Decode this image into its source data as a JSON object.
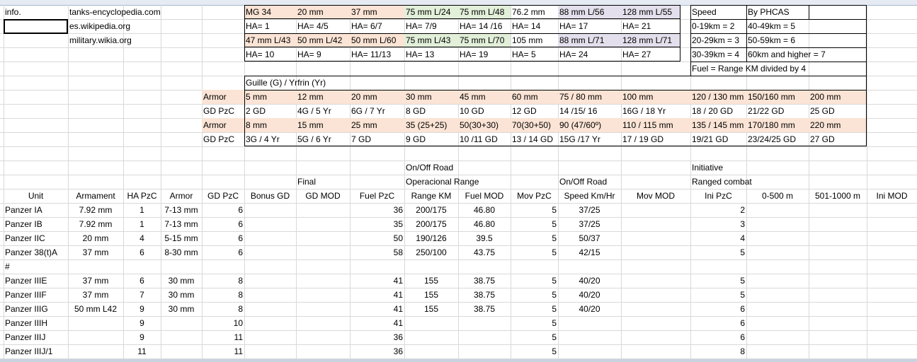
{
  "sources": [
    "info.",
    "tanks-encyclopedia.com",
    "es.wikipedia.org",
    "military.wikia.org"
  ],
  "guns_row1": [
    "MG 34",
    "20 mm",
    "37 mm",
    "75 mm L/24",
    "75 mm L/48",
    "76.2 mm",
    "88 mm L/56",
    "128 mm L/55"
  ],
  "ha_row1": [
    "HA= 1",
    "HA= 4/5",
    "HA= 6/7",
    "HA= 7/9",
    "HA= 14 /16",
    "HA= 14",
    "HA= 17",
    "HA= 21"
  ],
  "guns_row2": [
    "47 mm L/43",
    "50 mm L/42",
    "50 mm L/60",
    "75 mm L/43",
    "75 mm L/70",
    "105 mm",
    "88 mm L/71",
    "128 mm L/71"
  ],
  "ha_row2": [
    "HA= 10",
    "HA= 9",
    "HA= 11/13",
    "HA= 13",
    "HA= 19",
    "HA=  5",
    "HA= 24",
    "HA= 27"
  ],
  "speed": {
    "title": "Speed",
    "by": "By PHCAS",
    "rows": [
      [
        "0-19km = 2",
        "40-49km = 5"
      ],
      [
        "20-29km = 3",
        "50-59km = 6"
      ],
      [
        "30-39km = 4",
        "60km and higher = 7"
      ]
    ],
    "fuel": "Fuel = Range KM divided by 4"
  },
  "guille": "Guille (G) / Yrfrin (Yr)",
  "armor_rows": [
    {
      "label": "Armor",
      "vals": [
        "5 mm",
        "12 mm",
        "20 mm",
        "30 mm",
        "45 mm",
        "60 mm",
        "75 / 80 mm",
        "100 mm",
        "120 / 130 mm",
        "150/160 mm",
        "200 mm"
      ]
    },
    {
      "label": "GD PzC",
      "vals": [
        "2 GD",
        "4G / 5 Yr",
        "6G / 7 Yr",
        "8 GD",
        "10 GD",
        "12 GD",
        "14 /15/ 16",
        "16G / 18 Yr",
        "18 / 20 GD",
        "21/22 GD",
        "25 GD"
      ]
    },
    {
      "label": "Armor",
      "vals": [
        "8 mm",
        "15 mm",
        "25 mm",
        "35 (25+25)",
        "50(30+30)",
        "70(30+50)",
        "90 (47/60º)",
        "110 / 115 mm",
        "135 / 145 mm",
        "170/180 mm",
        "220 mm"
      ]
    },
    {
      "label": "GD PzC",
      "vals": [
        "3G / 4 Yr",
        "5G / 6 Yr",
        "7 GD",
        "9 GD",
        "10 /11 GD",
        "13 / 14 GD",
        "15G /17 Yr",
        "17 / 19 GD",
        "19/21 GD",
        "23/24/25 GD",
        "27 GD"
      ]
    }
  ],
  "group_headers": {
    "on_off_road_1": "On/Off Road",
    "final": "Final",
    "operacional": "Operacional Range",
    "on_off_road_2": "On/Off Road",
    "initiative": "Initiative",
    "ranged": "Ranged combat"
  },
  "columns": [
    "Unit",
    "Armament",
    "HA PzC",
    "Armor",
    "GD PzC",
    "Bonus GD",
    "GD MOD",
    "Fuel PzC",
    "Range KM",
    "Fuel MOD",
    "Mov PzC",
    "Speed Km/Hr",
    "Mov MOD",
    "Ini PzC",
    "0-500 m",
    "501-1000 m",
    "Ini MOD"
  ],
  "units": [
    {
      "unit": "Panzer IA",
      "arm": "7.92 mm",
      "ha": "1",
      "armor": "7-13 mm",
      "gd": "6",
      "fuel": "36",
      "range": "200/175",
      "fmod": "46.80",
      "mov": "5",
      "speed": "37/25",
      "ini": "2"
    },
    {
      "unit": "Panzer IB",
      "arm": "7.92 mm",
      "ha": "1",
      "armor": "7-13 mm",
      "gd": "6",
      "fuel": "35",
      "range": "200/175",
      "fmod": "46.80",
      "mov": "5",
      "speed": "37/25",
      "ini": "3"
    },
    {
      "unit": "Panzer IIC",
      "arm": "20 mm",
      "ha": "4",
      "armor": "5-15 mm",
      "gd": "6",
      "fuel": "50",
      "range": "190/126",
      "fmod": "39.5",
      "mov": "5",
      "speed": "50/37",
      "ini": "4"
    },
    {
      "unit": "Panzer 38(t)A",
      "arm": "37 mm",
      "ha": "6",
      "armor": "8-30 mm",
      "gd": "6",
      "fuel": "58",
      "range": "250/100",
      "fmod": "43.75",
      "mov": "5",
      "speed": "42/15",
      "ini": "5"
    },
    {
      "unit": "#",
      "arm": "",
      "ha": "",
      "armor": "",
      "gd": "",
      "fuel": "",
      "range": "",
      "fmod": "",
      "mov": "",
      "speed": "",
      "ini": ""
    },
    {
      "unit": "Panzer IIIE",
      "arm": "37 mm",
      "ha": "6",
      "armor": "30 mm",
      "gd": "8",
      "fuel": "41",
      "range": "155",
      "fmod": "38.75",
      "mov": "5",
      "speed": "40/20",
      "ini": "5"
    },
    {
      "unit": "Panzer IIIF",
      "arm": "37 mm",
      "ha": "7",
      "armor": "30 mm",
      "gd": "8",
      "fuel": "41",
      "range": "155",
      "fmod": "38.75",
      "mov": "5",
      "speed": "40/20",
      "ini": "5"
    },
    {
      "unit": "Panzer IIIG",
      "arm": "50 mm L42",
      "ha": "9",
      "armor": "30 mm",
      "gd": "8",
      "fuel": "41",
      "range": "155",
      "fmod": "38.75",
      "mov": "5",
      "speed": "40/20",
      "ini": "6"
    },
    {
      "unit": "Panzer IIIH",
      "arm": "",
      "ha": "9",
      "armor": "",
      "gd": "10",
      "fuel": "41",
      "range": "",
      "fmod": "",
      "mov": "5",
      "speed": "",
      "ini": "6"
    },
    {
      "unit": "Panzer IIIJ",
      "arm": "",
      "ha": "9",
      "armor": "",
      "gd": "11",
      "fuel": "36",
      "range": "",
      "fmod": "",
      "mov": "5",
      "speed": "",
      "ini": "6"
    },
    {
      "unit": "Panzer IIIJ/1",
      "arm": "",
      "ha": "11",
      "armor": "",
      "gd": "11",
      "fuel": "36",
      "range": "",
      "fmod": "",
      "mov": "5",
      "speed": "",
      "ini": "8"
    }
  ]
}
